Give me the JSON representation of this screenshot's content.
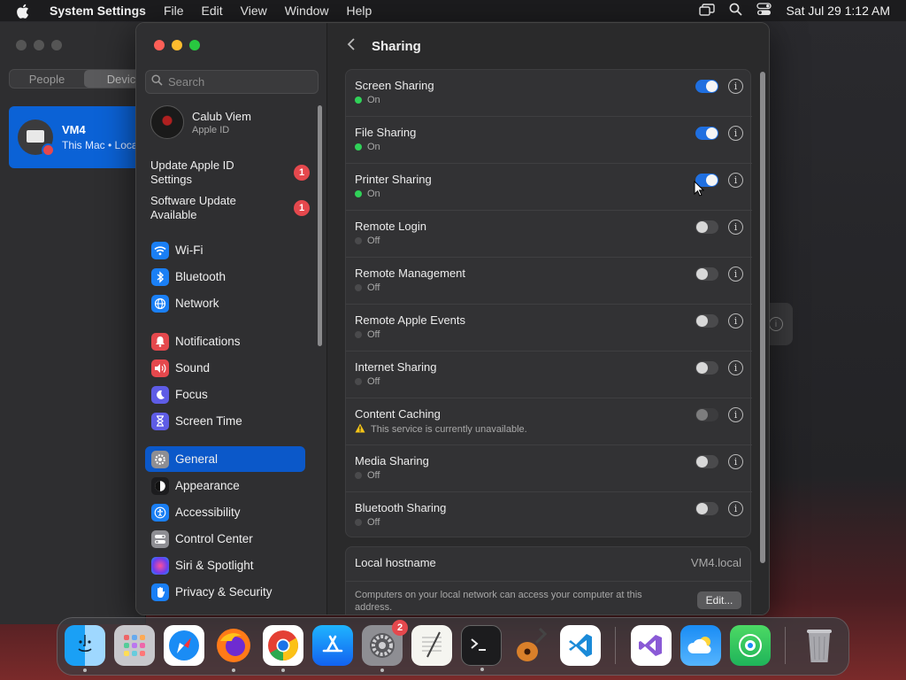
{
  "menubar": {
    "app_name": "System Settings",
    "menus": [
      "File",
      "Edit",
      "View",
      "Window",
      "Help"
    ],
    "clock": "Sat Jul 29  1:12 AM"
  },
  "background_window": {
    "tabs": [
      "People",
      "Devic"
    ],
    "device_name": "VM4",
    "device_subtitle": "This Mac • Loca"
  },
  "sidebar": {
    "search_placeholder": "Search",
    "account": {
      "name": "Calub Viem",
      "subtitle": "Apple ID"
    },
    "alerts": [
      {
        "label": "Update Apple ID Settings",
        "badge": "1"
      },
      {
        "label": "Software Update Available",
        "badge": "1"
      }
    ],
    "items": [
      {
        "label": "Wi-Fi",
        "icon": "wifi-icon",
        "color": "#1a7ff5"
      },
      {
        "label": "Bluetooth",
        "icon": "bluetooth-icon",
        "color": "#1a7ff5"
      },
      {
        "label": "Network",
        "icon": "globe-icon",
        "color": "#1a7ff5"
      },
      {
        "label": "Notifications",
        "icon": "bell-icon",
        "color": "#e5484d"
      },
      {
        "label": "Sound",
        "icon": "speaker-icon",
        "color": "#e5484d"
      },
      {
        "label": "Focus",
        "icon": "moon-icon",
        "color": "#5e5ce6"
      },
      {
        "label": "Screen Time",
        "icon": "hourglass-icon",
        "color": "#5e5ce6"
      },
      {
        "label": "General",
        "icon": "gear-icon",
        "color": "#8e8e93",
        "active": true
      },
      {
        "label": "Appearance",
        "icon": "appearance-icon",
        "color": "#1c1c1e"
      },
      {
        "label": "Accessibility",
        "icon": "accessibility-icon",
        "color": "#1a7ff5"
      },
      {
        "label": "Control Center",
        "icon": "control-center-icon",
        "color": "#8e8e93"
      },
      {
        "label": "Siri & Spotlight",
        "icon": "siri-icon",
        "color": "#b04bd6"
      },
      {
        "label": "Privacy & Security",
        "icon": "hand-icon",
        "color": "#1a7ff5"
      }
    ]
  },
  "content": {
    "title": "Sharing",
    "services": [
      {
        "name": "Screen Sharing",
        "status": "On",
        "enabled": true
      },
      {
        "name": "File Sharing",
        "status": "On",
        "enabled": true
      },
      {
        "name": "Printer Sharing",
        "status": "On",
        "enabled": true
      },
      {
        "name": "Remote Login",
        "status": "Off",
        "enabled": false
      },
      {
        "name": "Remote Management",
        "status": "Off",
        "enabled": false
      },
      {
        "name": "Remote Apple Events",
        "status": "Off",
        "enabled": false
      },
      {
        "name": "Internet Sharing",
        "status": "Off",
        "enabled": false
      },
      {
        "name": "Content Caching",
        "status": "This service is currently unavailable.",
        "enabled": false,
        "warning": true
      },
      {
        "name": "Media Sharing",
        "status": "Off",
        "enabled": false
      },
      {
        "name": "Bluetooth Sharing",
        "status": "Off",
        "enabled": false
      }
    ],
    "hostname": {
      "label": "Local hostname",
      "value": "VM4.local",
      "description": "Computers on your local network can access your computer at this address.",
      "edit_label": "Edit..."
    }
  },
  "dock": {
    "apps": [
      {
        "name": "Finder",
        "icon": "finder-icon",
        "running": true
      },
      {
        "name": "Launchpad",
        "icon": "launchpad-icon",
        "running": false
      },
      {
        "name": "Safari",
        "icon": "safari-icon",
        "running": false
      },
      {
        "name": "Firefox",
        "icon": "firefox-icon",
        "running": true
      },
      {
        "name": "Chrome",
        "icon": "chrome-icon",
        "running": true
      },
      {
        "name": "App Store",
        "icon": "app-store-icon",
        "running": false
      },
      {
        "name": "System Settings",
        "icon": "system-settings-icon",
        "running": true,
        "badge": "2"
      },
      {
        "name": "TextEdit",
        "icon": "textedit-icon",
        "running": false
      },
      {
        "name": "Terminal",
        "icon": "terminal-icon",
        "running": true
      },
      {
        "name": "GarageBand",
        "icon": "garageband-icon",
        "running": false
      },
      {
        "name": "Visual Studio Code",
        "icon": "vscode-icon",
        "running": false
      },
      {
        "name": "Visual Studio",
        "icon": "visual-studio-icon",
        "running": false
      },
      {
        "name": "Weather",
        "icon": "weather-icon",
        "running": false
      },
      {
        "name": "Find My",
        "icon": "findmy-icon",
        "running": false
      },
      {
        "name": "Trash",
        "icon": "trash-icon",
        "running": false
      }
    ]
  }
}
